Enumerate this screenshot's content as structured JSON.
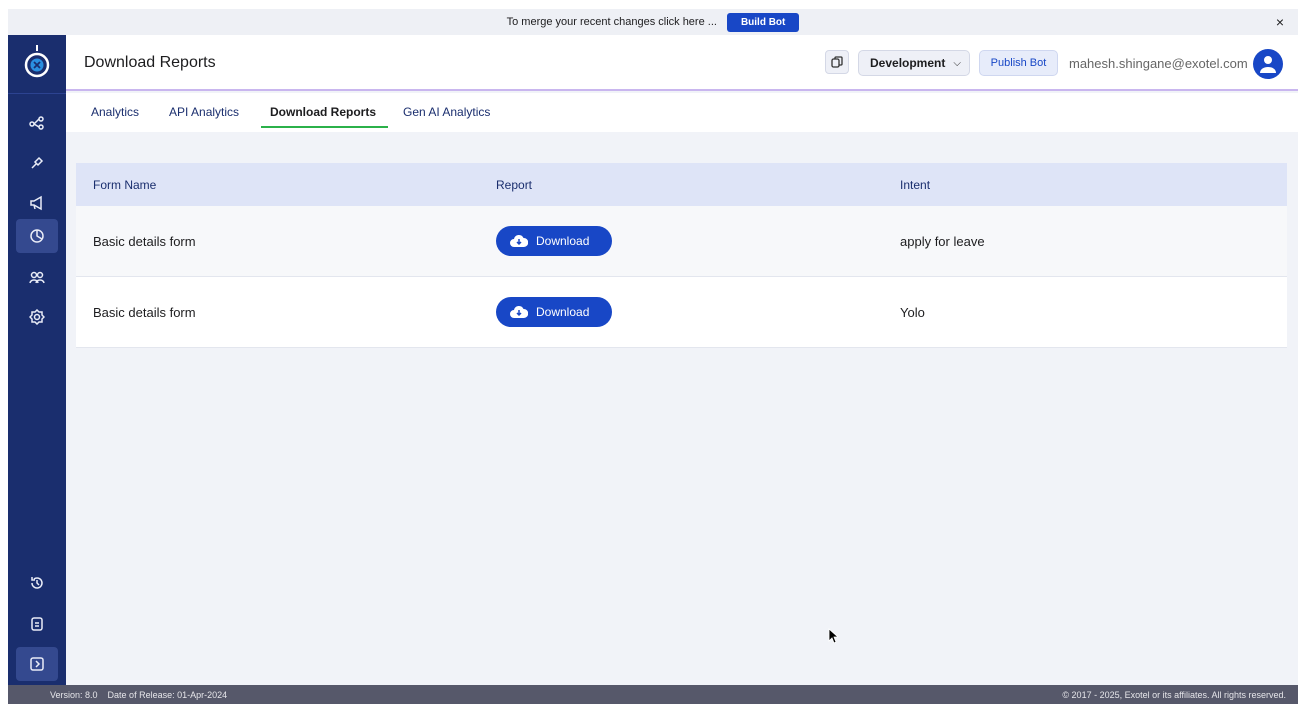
{
  "banner": {
    "message": "To merge your recent changes click here ...",
    "build_label": "Build Bot",
    "close": "×"
  },
  "header": {
    "title": "Download Reports",
    "environment": "Development",
    "publish_label": "Publish Bot",
    "user_email": "mahesh.shingane@exotel.com"
  },
  "tabs": [
    {
      "label": "Analytics"
    },
    {
      "label": "API Analytics"
    },
    {
      "label": "Download Reports"
    },
    {
      "label": "Gen AI Analytics"
    }
  ],
  "table": {
    "headers": {
      "form_name": "Form Name",
      "report": "Report",
      "intent": "Intent"
    },
    "rows": [
      {
        "form_name": "Basic details form",
        "report": "Download",
        "intent": "apply for leave"
      },
      {
        "form_name": "Basic details form",
        "report": "Download",
        "intent": "Yolo"
      }
    ]
  },
  "footer": {
    "version": "Version: 8.0",
    "release": "Date of Release: 01-Apr-2024",
    "copyright": "© 2017 - 2025, Exotel or its affiliates. All rights reserved."
  },
  "colors": {
    "sidebar": "#1a2e6e",
    "primary": "#1847c6",
    "active_tab": "#2bb14a",
    "table_header": "#dee4f7"
  }
}
